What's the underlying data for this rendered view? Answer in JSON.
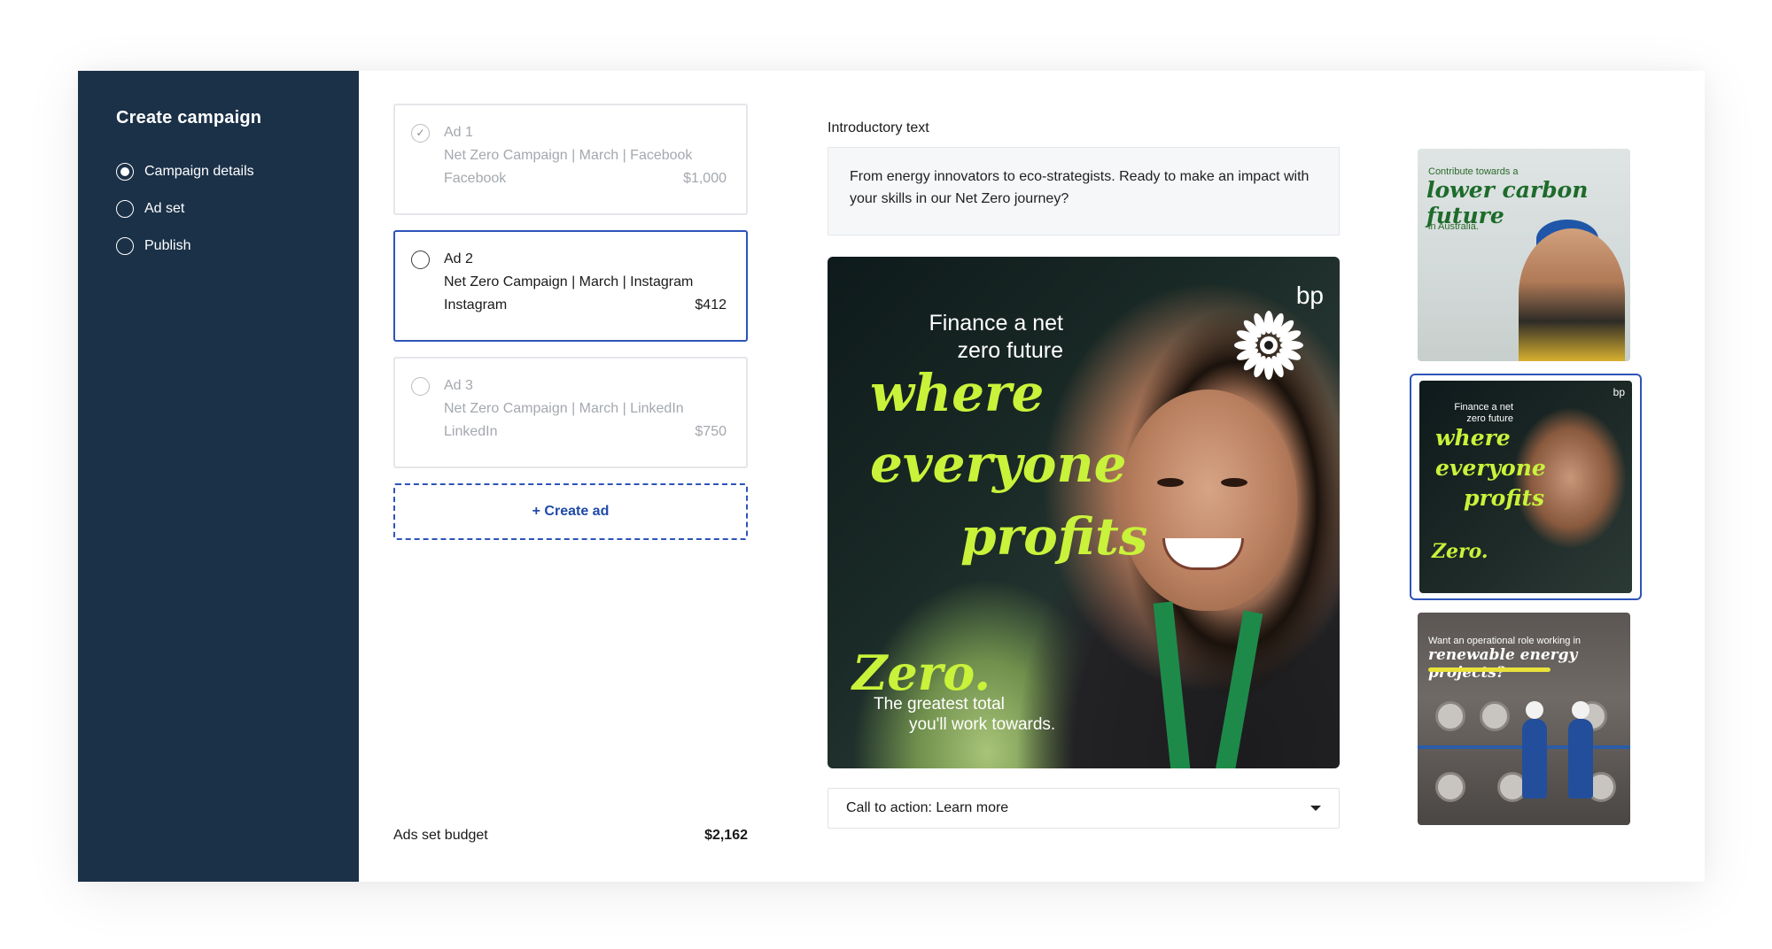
{
  "sidebar": {
    "title": "Create campaign",
    "steps": [
      {
        "label": "Campaign details",
        "checked": true
      },
      {
        "label": "Ad set",
        "checked": false
      },
      {
        "label": "Publish",
        "checked": false
      }
    ]
  },
  "ads": [
    {
      "name": "Ad 1",
      "title": "Net Zero Campaign | March | Facebook",
      "platform": "Facebook",
      "amount": "$1,000",
      "state": "done"
    },
    {
      "name": "Ad 2",
      "title": "Net Zero Campaign | March | Instagram",
      "platform": "Instagram",
      "amount": "$412",
      "state": "selected"
    },
    {
      "name": "Ad 3",
      "title": "Net Zero Campaign | March | LinkedIn",
      "platform": "LinkedIn",
      "amount": "$750",
      "state": "pending"
    }
  ],
  "create_ad_label": "+ Create ad",
  "budget": {
    "label": "Ads set budget",
    "amount": "$2,162"
  },
  "preview": {
    "intro_label": "Introductory text",
    "intro_text": "From energy innovators to eco-strategists. Ready to make an impact with your skills in our Net Zero journey?",
    "image": {
      "headline_1": "Finance a net",
      "headline_2": "zero future",
      "script_1": "where",
      "script_2": "everyone",
      "script_3": "profits",
      "zero": "Zero.",
      "tagline_1": "The greatest total",
      "tagline_2": "you'll work towards.",
      "brand": "bp"
    },
    "cta": "Call to action: Learn more"
  },
  "thumbnails": {
    "t1": {
      "small_1": "Contribute towards a",
      "script": "lower carbon future",
      "small_2": "in Australia."
    },
    "t2": {
      "headline": "Finance a net zero future",
      "s1": "where",
      "s2": "everyone",
      "s3": "profits",
      "zero": "Zero.",
      "brand": "bp"
    },
    "t3": {
      "headline": "Want an operational role working in",
      "script": "renewable energy projects?"
    }
  },
  "colors": {
    "sidebar": "#1b3148",
    "accent": "#2d54b8",
    "lime": "#c9f23a"
  }
}
